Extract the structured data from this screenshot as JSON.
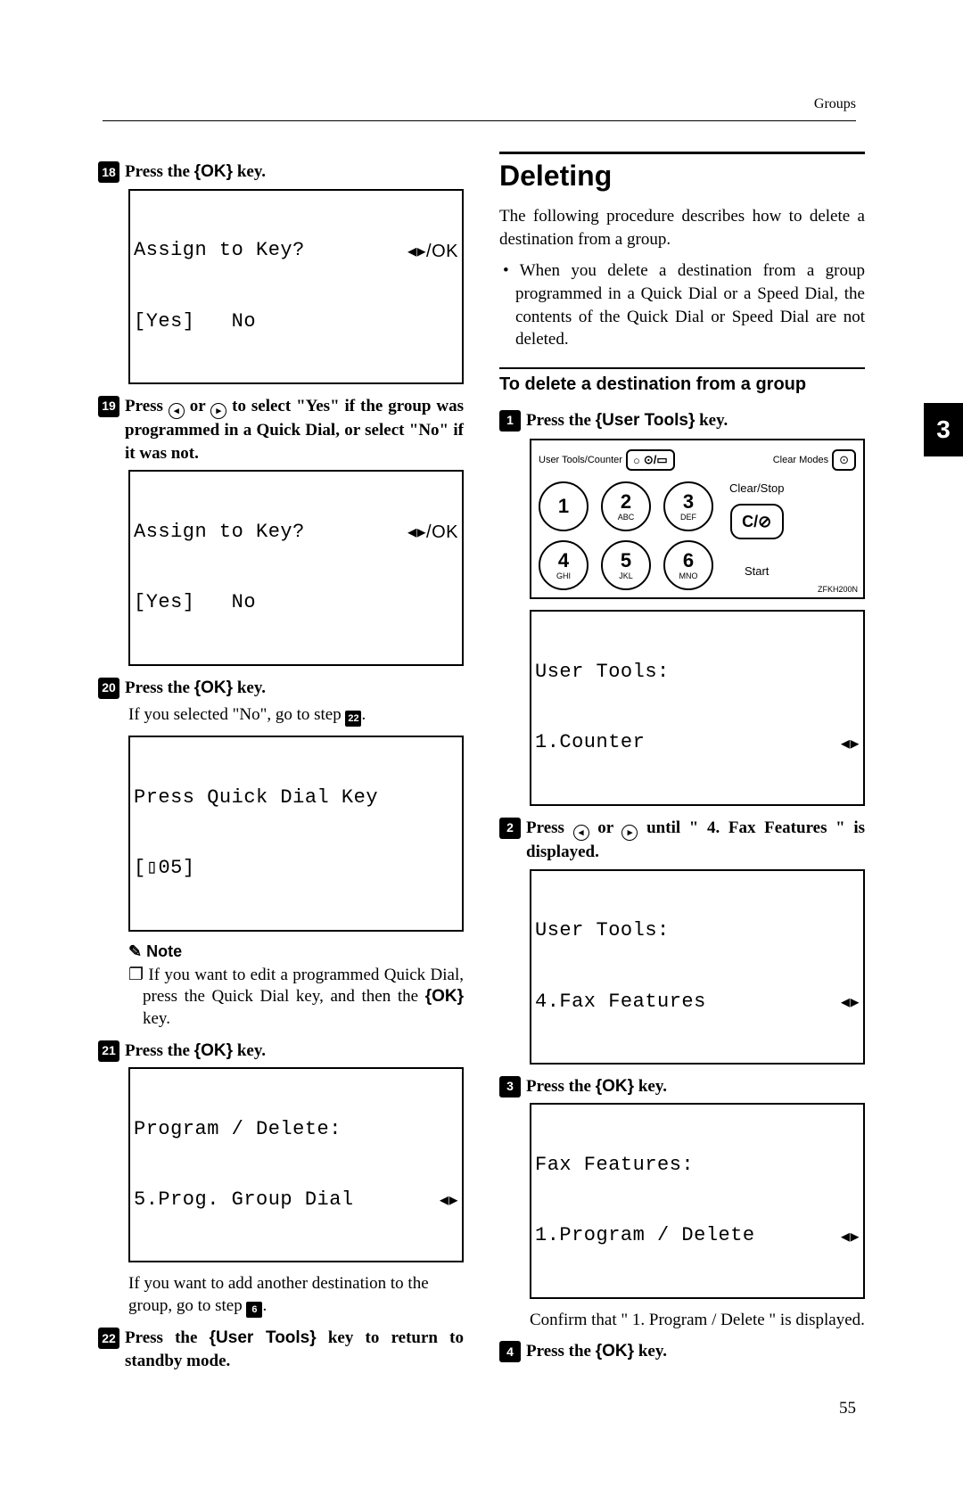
{
  "header": {
    "section": "Groups"
  },
  "chapter_tab": "3",
  "page_number": "55",
  "left": {
    "step18": {
      "num": "18",
      "text_before": "Press the ",
      "key": "OK",
      "text_after": " key."
    },
    "lcd1": {
      "line1a": "Assign to Key?",
      "line1b": "◂▸/OK",
      "line2": "[Yes]   No"
    },
    "step19": {
      "num": "19",
      "text": "Press   or   to select \"Yes\" if the group was programmed in a Quick Dial, or select \"No\" if it was not.",
      "text_a": "Press ",
      "arrow_l": "◂",
      "text_b": " or ",
      "arrow_r": "▸",
      "text_c": " to select \"Yes\" if the group was programmed in a Quick Dial, or select \"No\" if it was not."
    },
    "lcd2": {
      "line1a": "Assign to Key?",
      "line1b": "◂▸/OK",
      "line2": "[Yes]   No"
    },
    "step20": {
      "num": "20",
      "text_before": "Press the ",
      "key": "OK",
      "text_after": " key."
    },
    "body20_a": "If you selected \"No\", go to step ",
    "body20_ref": "22",
    "body20_b": ".",
    "lcd3": {
      "line1": "Press Quick Dial Key",
      "line2": "[▯05]"
    },
    "note_head": "Note",
    "note_item_a": "If you want to edit a programmed Quick Dial, press the Quick Dial key, and then the ",
    "note_item_key": "OK",
    "note_item_b": " key.",
    "step21": {
      "num": "21",
      "text_before": "Press the ",
      "key": "OK",
      "text_after": " key."
    },
    "lcd4": {
      "line1": "Program / Delete:",
      "line2a": "5.Prog. Group Dial",
      "line2b": "◂▸"
    },
    "body21_a": "If you want to add another destination to the group, go to step ",
    "body21_ref": "6",
    "body21_b": ".",
    "step22": {
      "num": "22",
      "text_before": "Press the ",
      "key": "User Tools",
      "text_after": " key to return to standby mode."
    }
  },
  "right": {
    "title": "Deleting",
    "intro": "The following procedure describes how to delete a destination from a group.",
    "bullet": "When you delete a destination from a group programmed in a Quick Dial or a Speed Dial, the contents of the Quick Dial or Speed Dial are not deleted.",
    "subhead": "To delete a destination from a group",
    "step1": {
      "num": "1",
      "text_before": "Press the ",
      "key": "User Tools",
      "text_after": " key."
    },
    "panel": {
      "usertools_label": "User Tools/Counter",
      "clearmodes_label": "Clear Modes",
      "keys": [
        {
          "d": "1",
          "s": ""
        },
        {
          "d": "2",
          "s": "ABC"
        },
        {
          "d": "3",
          "s": "DEF"
        },
        {
          "d": "4",
          "s": "GHI"
        },
        {
          "d": "5",
          "s": "JKL"
        },
        {
          "d": "6",
          "s": "MNO"
        }
      ],
      "clearstop": "Clear/Stop",
      "clearstop_btn": "C/⊘",
      "start": "Start",
      "code": "ZFKH200N"
    },
    "lcd1": {
      "line1": "User Tools:",
      "line2a": "1.Counter",
      "line2b": "◂▸"
    },
    "step2": {
      "num": "2",
      "text_a": "Press ",
      "arrow_l": "◂",
      "text_b": " or ",
      "arrow_r": "▸",
      "text_c": " until \" 4. Fax Features \" is displayed."
    },
    "lcd2": {
      "line1": "User Tools:",
      "line2a": "4.Fax Features",
      "line2b": "◂▸"
    },
    "step3": {
      "num": "3",
      "text_before": "Press the ",
      "key": "OK",
      "text_after": " key."
    },
    "lcd3": {
      "line1": "Fax Features:",
      "line2a": "1.Program / Delete",
      "line2b": "◂▸"
    },
    "body3": "Confirm that \" 1. Program / Delete \" is displayed.",
    "step4": {
      "num": "4",
      "text_before": "Press the ",
      "key": "OK",
      "text_after": " key."
    }
  }
}
